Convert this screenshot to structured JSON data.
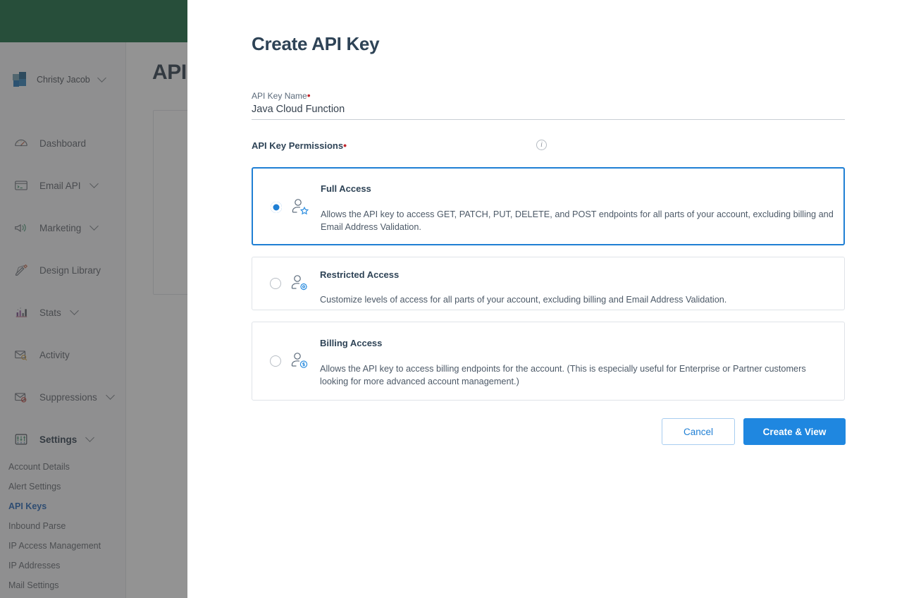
{
  "background": {
    "topbar_color": "#11663a",
    "account": {
      "name": "Christy Jacob",
      "chevron": "chevron-down-icon"
    },
    "nav": [
      {
        "label": "Dashboard",
        "icon": "gauge-icon",
        "expandable": false
      },
      {
        "label": "Email API",
        "icon": "terminal-icon",
        "expandable": true
      },
      {
        "label": "Marketing",
        "icon": "megaphone-icon",
        "expandable": true
      },
      {
        "label": "Design Library",
        "icon": "ruler-pencil-icon",
        "expandable": false
      },
      {
        "label": "Stats",
        "icon": "bar-chart-icon",
        "expandable": true
      },
      {
        "label": "Activity",
        "icon": "envelope-search-icon",
        "expandable": false
      },
      {
        "label": "Suppressions",
        "icon": "envelope-block-icon",
        "expandable": true
      },
      {
        "label": "Settings",
        "icon": "sliders-icon",
        "expandable": true,
        "active": true
      }
    ],
    "settings_subnav": [
      {
        "label": "Account Details",
        "selected": false
      },
      {
        "label": "Alert Settings",
        "selected": false
      },
      {
        "label": "API Keys",
        "selected": true
      },
      {
        "label": "Inbound Parse",
        "selected": false
      },
      {
        "label": "IP Access Management",
        "selected": false
      },
      {
        "label": "IP Addresses",
        "selected": false
      },
      {
        "label": "Mail Settings",
        "selected": false
      }
    ],
    "page_title": "API"
  },
  "modal": {
    "title": "Create API Key",
    "key_name": {
      "label": "API Key Name",
      "required_marker": "•",
      "value": "Java Cloud Function",
      "placeholder": "",
      "info_icon": "info-icon"
    },
    "permissions": {
      "label": "API Key Permissions",
      "required_marker": "•",
      "info_icon": "info-icon",
      "options": [
        {
          "id": "full",
          "title": "Full Access",
          "description": "Allows the API key to access GET, PATCH, PUT, DELETE, and POST endpoints for all parts of your account, excluding billing and Email Address Validation.",
          "icon": "person-star-icon",
          "selected": true
        },
        {
          "id": "restricted",
          "title": "Restricted Access",
          "description": "Customize levels of access for all parts of your account, excluding billing and Email Address Validation.",
          "icon": "person-gear-icon",
          "selected": false
        },
        {
          "id": "billing",
          "title": "Billing Access",
          "description": "Allows the API key to access billing endpoints for the account. (This is especially useful for Enterprise or Partner customers looking for more advanced account management.)",
          "icon": "person-dollar-icon",
          "selected": false
        }
      ]
    },
    "buttons": {
      "cancel": "Cancel",
      "create": "Create & View"
    },
    "colors": {
      "accent": "#1f7fd4",
      "primary_button": "#1f87e0",
      "title": "#2e4356",
      "required": "#c0272d"
    }
  }
}
